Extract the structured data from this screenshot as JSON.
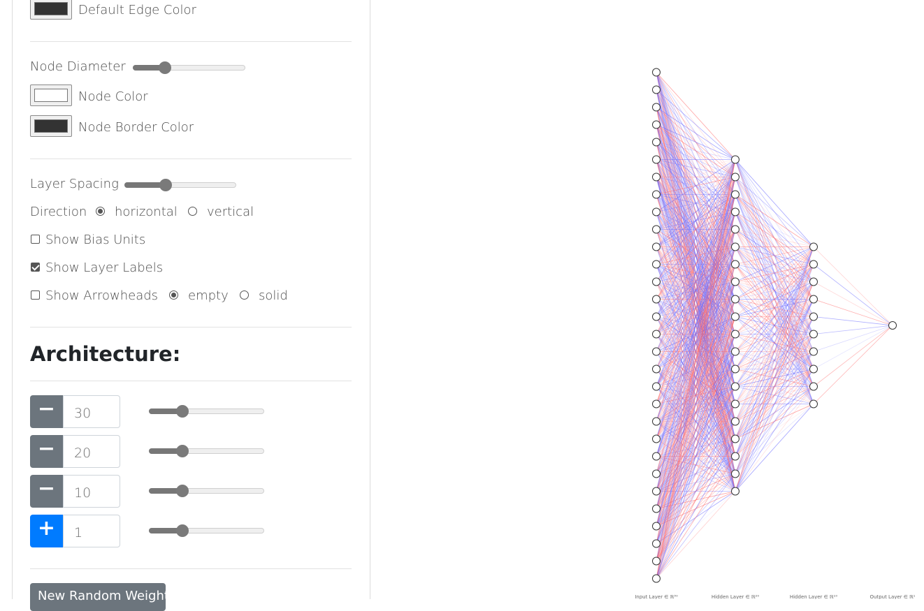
{
  "controls": {
    "default_edge_color_label": "Default Edge Color",
    "node_diameter_label": "Node Diameter",
    "node_color_label": "Node Color",
    "node_border_color_label": "Node Border Color",
    "layer_spacing_label": "Layer Spacing",
    "direction_label": "Direction",
    "direction_options": [
      "horizontal",
      "vertical"
    ],
    "direction_selected": "horizontal",
    "show_bias_units_label": "Show Bias Units",
    "show_bias_units_checked": false,
    "show_layer_labels_label": "Show Layer Labels",
    "show_layer_labels_checked": true,
    "show_arrowheads_label": "Show Arrowheads",
    "show_arrowheads_checked": false,
    "arrowhead_options": [
      "empty",
      "solid"
    ],
    "arrowhead_selected": "empty",
    "node_diameter_value_fraction": 0.28,
    "layer_spacing_value_fraction": 0.37,
    "colors": {
      "default_edge": "#333333",
      "node": "#ffffff",
      "node_border": "#333333",
      "positive_weight": "#ff6666",
      "negative_weight": "#6666ff"
    }
  },
  "architecture": {
    "title": "Architecture:",
    "layers": [
      {
        "value": "30",
        "button": "minus-icon",
        "slider_fraction": 0.3
      },
      {
        "value": "20",
        "button": "minus-icon",
        "slider_fraction": 0.3
      },
      {
        "value": "10",
        "button": "minus-icon",
        "slider_fraction": 0.3
      },
      {
        "value": "1",
        "button": "plus-icon",
        "slider_fraction": 0.3
      }
    ],
    "new_weights_button": "New Random Weights"
  },
  "network": {
    "layer_sizes": [
      30,
      20,
      10,
      1
    ],
    "layer_labels": [
      "Input Layer ∈ ℝ³⁰",
      "Hidden Layer ∈ ℝ²⁰",
      "Hidden Layer ∈ ℝ¹⁰",
      "Output Layer ∈ ℝ¹"
    ]
  }
}
